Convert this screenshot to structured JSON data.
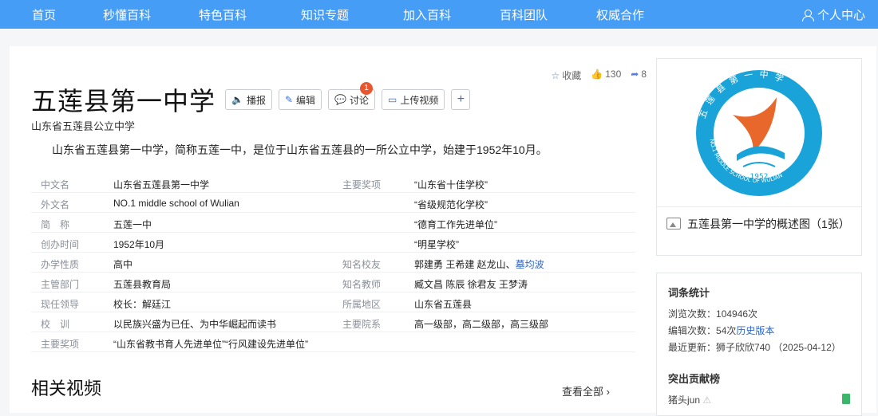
{
  "nav": {
    "items": [
      "首页",
      "秒懂百科",
      "特色百科",
      "知识专题",
      "加入百科",
      "百科团队",
      "权威合作"
    ],
    "user_label": "个人中心"
  },
  "entry": {
    "title": "五莲县第一中学",
    "subtitle": "山东省五莲县公立中学",
    "summary": "山东省五莲县第一中学，简称五莲一中，是位于山东省五莲县的一所公立中学，始建于1952年10月。",
    "buttons": {
      "play": "播报",
      "edit": "编辑",
      "discuss": "讨论",
      "discuss_badge": "1",
      "upload": "上传视频",
      "plus": "+"
    },
    "stats": {
      "favorite": "收藏",
      "likes": "130",
      "shares": "8"
    }
  },
  "info_left": [
    {
      "label": "中文名",
      "value": "山东省五莲县第一中学"
    },
    {
      "label": "外文名",
      "value": "NO.1 middle school of Wulian"
    },
    {
      "label": "简　称",
      "value": "五莲一中"
    },
    {
      "label": "创办时间",
      "value": "1952年10月"
    },
    {
      "label": "办学性质",
      "value": "高中"
    },
    {
      "label": "主管部门",
      "value": "五莲县教育局"
    },
    {
      "label": "现任领导",
      "value": "校长：解廷江"
    },
    {
      "label": "校　训",
      "value": "以民族兴盛为已任、为中华崛起而读书"
    },
    {
      "label": "主要奖项",
      "value": "“山东省教书育人先进单位”“行风建设先进单位”"
    }
  ],
  "info_right": [
    {
      "label": "主要奖项",
      "value": "“山东省十佳学校”"
    },
    {
      "label": "",
      "value": "“省级规范化学校”"
    },
    {
      "label": "",
      "value": "“德育工作先进单位”"
    },
    {
      "label": "",
      "value": "“明星学校”"
    },
    {
      "label": "知名校友",
      "value": "郭建勇 王希建 赵龙山、",
      "link": "墓均波"
    },
    {
      "label": "知名教师",
      "value": "臧文昌 陈辰 徐君友 王梦涛"
    },
    {
      "label": "所属地区",
      "value": "山东省五莲县"
    },
    {
      "label": "主要院系",
      "value": "高一级部，高二级部，高三级部"
    }
  ],
  "related_videos": {
    "title": "相关视频",
    "more": "查看全部"
  },
  "sidebar": {
    "logo": {
      "arc_text": "五 莲 县 第 一 中 学",
      "ring_text": "NO.1 MIDDLE SCHOOL OF WULIAN",
      "year": "1952"
    },
    "image_caption": "五莲县第一中学的概述图（1张）",
    "stats_title": "词条统计",
    "views_label": "浏览次数：",
    "views": "104946次",
    "edits_label": "编辑次数：",
    "edits": "54次",
    "history_link": "历史版本",
    "updated_label": "最近更新：",
    "updated": "狮子欣欣740 （2025-04-12）",
    "contrib_title": "突出贡献榜",
    "contrib_user": "猪头jun"
  },
  "colors": {
    "nav": "#459df5",
    "link": "#2e66c9",
    "badge": "#e9552f"
  }
}
